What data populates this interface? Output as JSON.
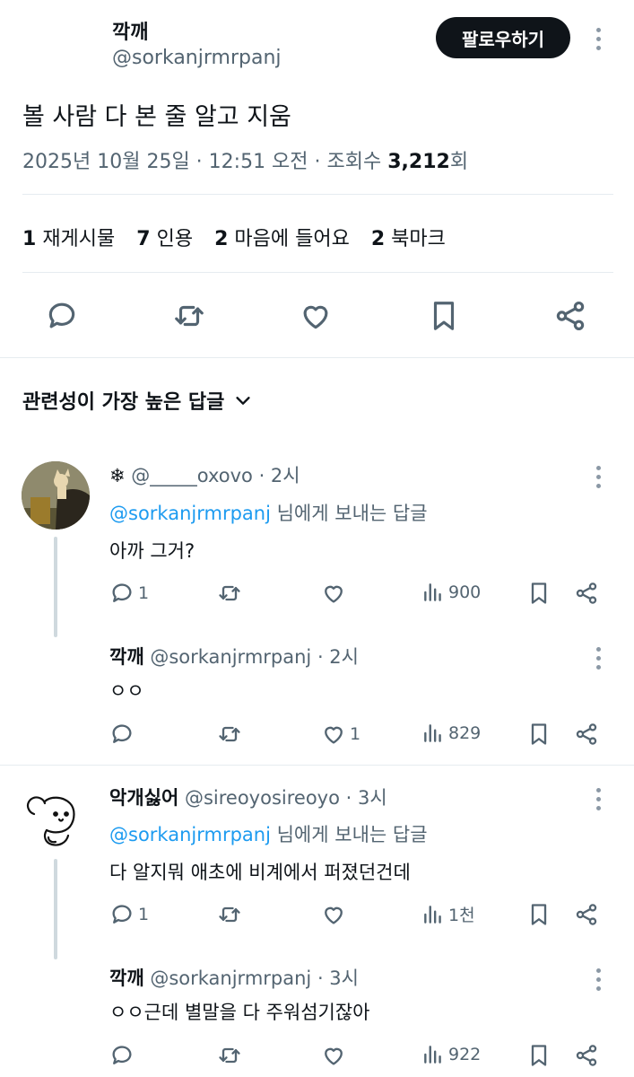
{
  "post": {
    "author_name": "깍깨",
    "author_handle": "@sorkanjrmrpanj",
    "follow_label": "팔로우하기",
    "text": "볼 사람 다 본 줄 알고 지움",
    "date": "2025년 10월 25일 · 12:51 오전 · 조회수 ",
    "views": "3,212",
    "views_suffix": "회",
    "stats": {
      "reposts_count": "1",
      "reposts_label": "재게시물",
      "quotes_count": "7",
      "quotes_label": "인용",
      "likes_count": "2",
      "likes_label": "마음에 들어요",
      "bookmarks_count": "2",
      "bookmarks_label": "북마크"
    }
  },
  "sort_label": "관련성이 가장 높은 답글",
  "replies": [
    {
      "name": "❄",
      "handle": "@_____oxovo",
      "time": " · 2시",
      "reply_to": "@sorkanjrmrpanj",
      "reply_suffix": " 님에게 보내는 답글",
      "text": "아까 그거?",
      "replies_count": "1",
      "retweets_count": "",
      "likes_count": "",
      "views": "900"
    },
    {
      "name": "깍깨",
      "handle": "@sorkanjrmrpanj",
      "time": " · 2시",
      "text": "ㅇㅇ",
      "replies_count": "",
      "retweets_count": "",
      "likes_count": "1",
      "views": "829"
    },
    {
      "name": "악개싫어",
      "handle": "@sireoyosireoyo",
      "time": " · 3시",
      "reply_to": "@sorkanjrmrpanj",
      "reply_suffix": " 님에게 보내는 답글",
      "text": "다 알지뭐 애초에 비계에서 퍼졌던건데",
      "replies_count": "1",
      "retweets_count": "",
      "likes_count": "",
      "views": "1천"
    },
    {
      "name": "깍깨",
      "handle": "@sorkanjrmrpanj",
      "time": " · 3시",
      "text": "ㅇㅇ근데 별말을 다 주워섬기잖아",
      "replies_count": "",
      "retweets_count": "",
      "likes_count": "",
      "views": "922"
    }
  ],
  "icons": {
    "reply": "speech-bubble-icon",
    "retweet": "repost-icon",
    "like": "heart-icon",
    "bookmark": "bookmark-icon",
    "share": "share-icon",
    "views": "bar-chart-icon",
    "more": "more-dots-icon",
    "chevron": "chevron-down-icon"
  }
}
